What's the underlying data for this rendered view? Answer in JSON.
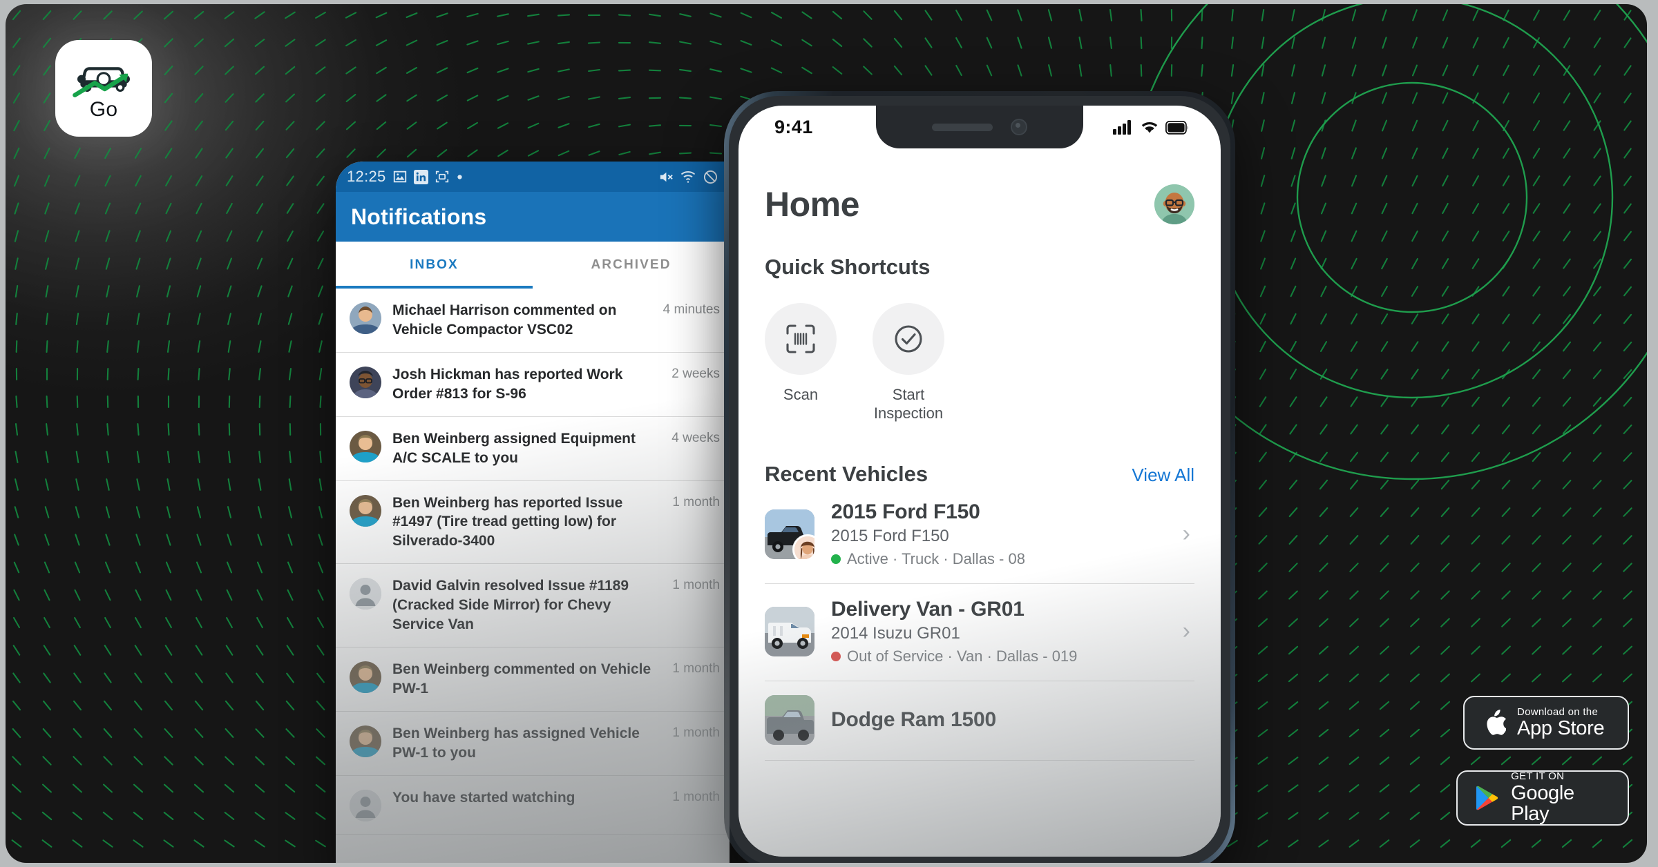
{
  "app_icon": {
    "label": "Go",
    "icon": "car-growth-icon"
  },
  "android": {
    "status_bar": {
      "time": "12:25",
      "left_icons": [
        "image-icon",
        "linkedin-icon",
        "screenshot-icon",
        "dot-icon"
      ],
      "right_icons": [
        "mute-icon",
        "wifi-icon",
        "do-not-disturb-icon"
      ]
    },
    "app_bar": {
      "title": "Notifications"
    },
    "tabs": [
      {
        "label": "INBOX",
        "selected": true
      },
      {
        "label": "ARCHIVED",
        "selected": false
      }
    ],
    "notifications": [
      {
        "text": "Michael Harrison commented on Vehicle Compactor VSC02",
        "time": "4 minutes",
        "avatar": "photo-male-young"
      },
      {
        "text": "Josh Hickman has reported Work Order #813 for S-96",
        "time": "2 weeks",
        "avatar": "memoji-glasses-dark"
      },
      {
        "text": "Ben Weinberg assigned Equipment A/C SCALE to you",
        "time": "4 weeks",
        "avatar": "photo-male-teal-shirt"
      },
      {
        "text": "Ben Weinberg has reported Issue #1497 (Tire tread getting low) for Silverado-3400",
        "time": "1 month",
        "avatar": "photo-male-teal-shirt"
      },
      {
        "text": "David Galvin resolved Issue #1189 (Cracked Side Mirror) for Chevy Service Van",
        "time": "1 month",
        "avatar": "placeholder-person"
      },
      {
        "text": "Ben Weinberg commented on Vehicle PW-1",
        "time": "1 month",
        "avatar": "photo-male-teal-shirt"
      },
      {
        "text": "Ben Weinberg has assigned Vehicle PW-1 to you",
        "time": "1 month",
        "avatar": "photo-male-teal-shirt"
      },
      {
        "text": "You have started watching",
        "time": "1 month",
        "avatar": "placeholder-person"
      }
    ]
  },
  "iphone": {
    "status_bar": {
      "time": "9:41",
      "icons": [
        "cellular-icon",
        "wifi-icon",
        "battery-icon"
      ]
    },
    "header": {
      "title": "Home",
      "avatar": "memoji-bald-glasses-beard"
    },
    "quick_shortcuts": {
      "title": "Quick Shortcuts",
      "items": [
        {
          "label": "Scan",
          "icon": "barcode-scan-icon"
        },
        {
          "label": "Start Inspection",
          "icon": "check-circle-icon"
        }
      ]
    },
    "recent_vehicles": {
      "title": "Recent Vehicles",
      "view_all": "View All",
      "items": [
        {
          "title": "2015 Ford F150",
          "subtitle": "2015 Ford F150",
          "status": "Active",
          "status_color": "#22b24c",
          "meta": "Active · Truck · Dallas - 08",
          "thumb": "black-pickup-truck",
          "has_avatar": true
        },
        {
          "title": "Delivery Van - GR01",
          "subtitle": "2014 Isuzu GR01",
          "status": "Out of Service",
          "status_color": "#d9534f",
          "meta": "Out of Service · Van · Dallas - 019",
          "thumb": "white-cargo-van",
          "has_avatar": false
        },
        {
          "title": "Dodge Ram 1500",
          "subtitle": "",
          "status": "",
          "status_color": "#22b24c",
          "meta": "",
          "thumb": "grey-pickup-truck",
          "has_avatar": false
        }
      ]
    }
  },
  "badges": {
    "apple": {
      "line1": "Download on the",
      "line2": "App Store",
      "icon": "apple-logo-icon"
    },
    "google": {
      "line1": "GET IT ON",
      "line2": "Google Play",
      "icon": "google-play-icon"
    }
  },
  "theme": {
    "accent_green": "#1f9d4d",
    "android_blue": "#1a73b8",
    "ios_blue": "#1577d4",
    "background_dark": "#171717"
  }
}
